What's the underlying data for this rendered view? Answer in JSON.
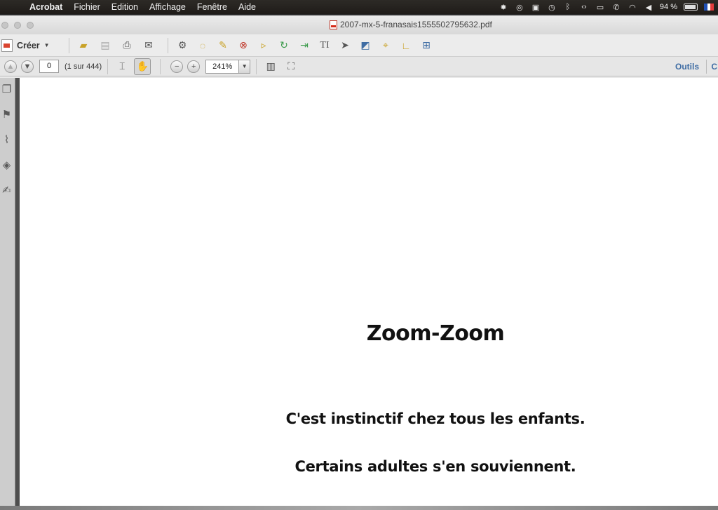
{
  "menubar": {
    "app_name": "Acrobat",
    "items": [
      "Fichier",
      "Edition",
      "Affichage",
      "Fenêtre",
      "Aide"
    ],
    "battery": "94 %",
    "battery_level": 0.94
  },
  "window": {
    "title": "2007-mx-5-franasais1555502795632.pdf"
  },
  "toolbar": {
    "create_label": "Créer"
  },
  "nav": {
    "page_value": "0",
    "page_count": "(1 sur 444)",
    "zoom_value": "241%",
    "tools_label": "Outils",
    "comment_label_partial": "C"
  },
  "document": {
    "title": "Zoom-Zoom",
    "line1": "C'est instinctif chez tous les enfants.",
    "line2": "Certains adultes s'en souviennent."
  },
  "colors": {
    "accent": "#3f6da4",
    "pdf_red": "#d62c1a"
  }
}
